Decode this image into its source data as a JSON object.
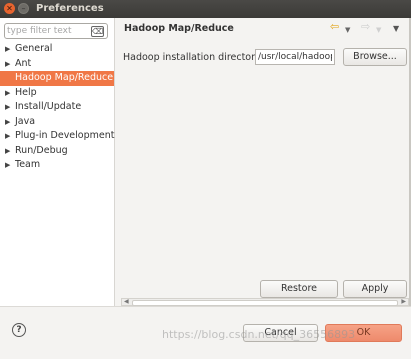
{
  "window": {
    "title": "Preferences",
    "close_glyph": "✕",
    "min_glyph": "–"
  },
  "filter": {
    "placeholder": "type filter text",
    "clear_glyph": "⌫"
  },
  "tree": {
    "items": [
      {
        "label": "General",
        "expandable": true,
        "selected": false
      },
      {
        "label": "Ant",
        "expandable": true,
        "selected": false
      },
      {
        "label": "Hadoop Map/Reduce",
        "expandable": false,
        "selected": true
      },
      {
        "label": "Help",
        "expandable": true,
        "selected": false
      },
      {
        "label": "Install/Update",
        "expandable": true,
        "selected": false
      },
      {
        "label": "Java",
        "expandable": true,
        "selected": false
      },
      {
        "label": "Plug-in Development",
        "expandable": true,
        "selected": false
      },
      {
        "label": "Run/Debug",
        "expandable": true,
        "selected": false
      },
      {
        "label": "Team",
        "expandable": true,
        "selected": false
      }
    ]
  },
  "page": {
    "title": "Hadoop Map/Reduce",
    "nav_icons": [
      "back-arrow-icon",
      "back-dropdown-icon",
      "forward-arrow-icon",
      "forward-dropdown-icon",
      "view-menu-icon"
    ]
  },
  "hadoop": {
    "label": "Hadoop installation directory:",
    "value": "/usr/local/hadoop",
    "browse_label": "Browse..."
  },
  "buttons": {
    "restore_defaults": "Restore Defaults",
    "apply": "Apply",
    "cancel": "Cancel",
    "ok": "OK",
    "help": "?"
  },
  "watermark": "https://blog.csdn.net/qq_36556893",
  "colors": {
    "selection": "#f07746",
    "ok_button": "#ee8a6c",
    "titlebar": "#3b3a37"
  }
}
